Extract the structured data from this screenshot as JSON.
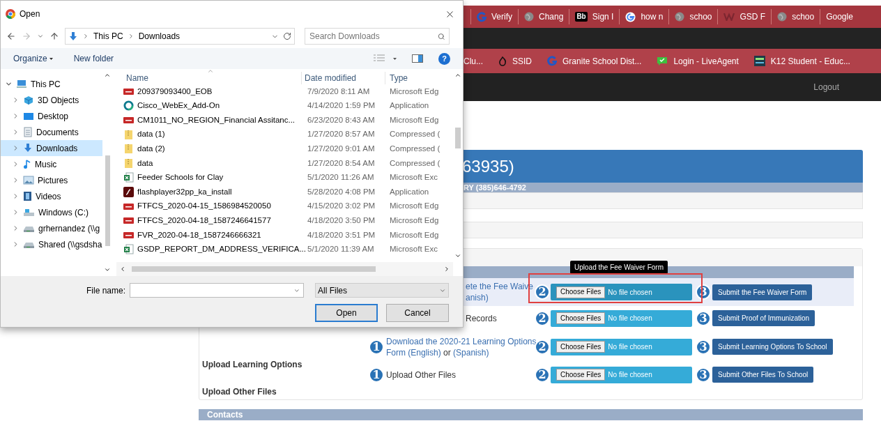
{
  "browser": {
    "tabs": [
      {
        "title": "Verify",
        "kind": "g"
      },
      {
        "title": "Chang",
        "kind": "globe"
      },
      {
        "title": "Sign I",
        "kind": "logo",
        "logo": "Bb"
      },
      {
        "title": "how n",
        "kind": "google"
      },
      {
        "title": "schoo",
        "kind": "globe"
      },
      {
        "title": "GSD F",
        "kind": "w"
      },
      {
        "title": "schoo",
        "kind": "globe"
      },
      {
        "title": "Google",
        "kind": "plain"
      }
    ],
    "bookmarks": [
      {
        "label": "Clu...",
        "kind": "plain"
      },
      {
        "label": "SSID",
        "kind": "flame"
      },
      {
        "label": "Granite School Dist...",
        "kind": "g"
      },
      {
        "label": "Login - LiveAgent",
        "kind": "chat"
      },
      {
        "label": "K12 Student - Educ...",
        "kind": "esd"
      }
    ],
    "logout": "Logout"
  },
  "page": {
    "header": {
      "title": "63935)",
      "subtitle": "RY (385)646-4792"
    },
    "tooltip": "Upload the Fee Waiver Form",
    "rows": [
      {
        "highlighted": true,
        "framed": true,
        "step1_badge": "",
        "step1": [
          [
            {
              "text": "ete the Fee Waive",
              "link": true
            }
          ],
          [
            {
              "text": "anish)",
              "link": true
            }
          ]
        ],
        "step2_badge": "2",
        "choose": "Choose Files",
        "chosen": "No file chosen",
        "step3_badge": "3",
        "submit": "Submit the Fee Waiver Form"
      },
      {
        "highlighted": false,
        "framed": false,
        "step1_badge": "",
        "step1": [
          [
            {
              "text": "Records",
              "link": false
            }
          ]
        ],
        "step2_badge": "2",
        "choose": "Choose Files",
        "chosen": "No file chosen",
        "step3_badge": "3",
        "submit": "Submit Proof of Immunization"
      },
      {
        "highlighted": false,
        "framed": false,
        "step1_badge": "1",
        "step1": [
          [
            {
              "text": "Download the 2020-21 Learning Options",
              "link": true
            }
          ],
          [
            {
              "text": "Form (English)",
              "link": true
            },
            {
              "text": " or ",
              "link": false
            },
            {
              "text": "(Spanish)",
              "link": true
            }
          ]
        ],
        "step2_badge": "2",
        "choose": "Choose Files",
        "chosen": "No file chosen",
        "step3_badge": "3",
        "submit": "Submit Learning Options To School"
      },
      {
        "highlighted": false,
        "framed": false,
        "step1_badge": "1",
        "step1": [
          [
            {
              "text": "Upload Other Files",
              "link": false
            }
          ]
        ],
        "step2_badge": "2",
        "choose": "Choose Files",
        "chosen": "No file chosen",
        "step3_badge": "3",
        "submit": "Submit Other Files To School"
      }
    ],
    "labels": [
      "Upload Learning Options",
      "Upload Other Files"
    ],
    "contacts": "Contacts"
  },
  "dialog": {
    "title": "Open",
    "path": [
      "This PC",
      "Downloads"
    ],
    "search_placeholder": "Search Downloads",
    "toolbar": [
      "Organize",
      "New folder"
    ],
    "help": "?",
    "nav": [
      {
        "label": "This PC",
        "kind": "pc",
        "expanded": true,
        "selected": false,
        "children": [
          {
            "label": "3D Objects",
            "kind": "cube",
            "expanded": false,
            "selected": false
          },
          {
            "label": "Desktop",
            "kind": "desktop",
            "expanded": false,
            "selected": false
          },
          {
            "label": "Documents",
            "kind": "docs",
            "expanded": false,
            "selected": false
          },
          {
            "label": "Downloads",
            "kind": "download",
            "expanded": false,
            "selected": true
          },
          {
            "label": "Music",
            "kind": "music",
            "expanded": false,
            "selected": false
          },
          {
            "label": "Pictures",
            "kind": "pictures",
            "expanded": false,
            "selected": false
          },
          {
            "label": "Videos",
            "kind": "videos",
            "expanded": false,
            "selected": false
          },
          {
            "label": "Windows (C:)",
            "kind": "drive",
            "expanded": false,
            "selected": false
          },
          {
            "label": "grhernandez (\\\\g",
            "kind": "netdrive",
            "expanded": false,
            "selected": false
          },
          {
            "label": "Shared (\\\\gsdsha",
            "kind": "netdrive",
            "expanded": false,
            "selected": false
          }
        ]
      }
    ],
    "columns": [
      "Name",
      "Date modified",
      "Type"
    ],
    "files": [
      {
        "name": "209379093400_EOB",
        "date": "7/9/2020 8:11 AM",
        "type": "Microsoft Edg",
        "kind": "pdf"
      },
      {
        "name": "Cisco_WebEx_Add-On",
        "date": "4/14/2020 1:59 PM",
        "type": "Application",
        "kind": "ring"
      },
      {
        "name": "CM1011_NO_REGION_Financial Assitanc...",
        "date": "6/23/2020 8:43 AM",
        "type": "Microsoft Edg",
        "kind": "pdf"
      },
      {
        "name": "data (1)",
        "date": "1/27/2020 8:57 AM",
        "type": "Compressed (",
        "kind": "zip"
      },
      {
        "name": "data (2)",
        "date": "1/27/2020 9:01 AM",
        "type": "Compressed (",
        "kind": "zip"
      },
      {
        "name": "data",
        "date": "1/27/2020 8:54 AM",
        "type": "Compressed (",
        "kind": "zip"
      },
      {
        "name": "Feeder Schools for Clay",
        "date": "5/1/2020 11:26 AM",
        "type": "Microsoft Exc",
        "kind": "excel"
      },
      {
        "name": "flashplayer32pp_ka_install",
        "date": "5/28/2020 4:08 PM",
        "type": "Application",
        "kind": "flash"
      },
      {
        "name": "FTFCS_2020-04-15_1586984520050",
        "date": "4/15/2020 3:02 PM",
        "type": "Microsoft Edg",
        "kind": "pdf"
      },
      {
        "name": "FTFCS_2020-04-18_1587246641577",
        "date": "4/18/2020 3:50 PM",
        "type": "Microsoft Edg",
        "kind": "pdf"
      },
      {
        "name": "FVR_2020-04-18_1587246666321",
        "date": "4/18/2020 3:51 PM",
        "type": "Microsoft Edg",
        "kind": "pdf"
      },
      {
        "name": "GSDP_REPORT_DM_ADDRESS_VERIFICA...",
        "date": "5/1/2020 11:39 AM",
        "type": "Microsoft Exc",
        "kind": "excel"
      }
    ],
    "file_name_label": "File name:",
    "file_type": "All Files",
    "buttons": [
      "Open",
      "Cancel"
    ]
  }
}
